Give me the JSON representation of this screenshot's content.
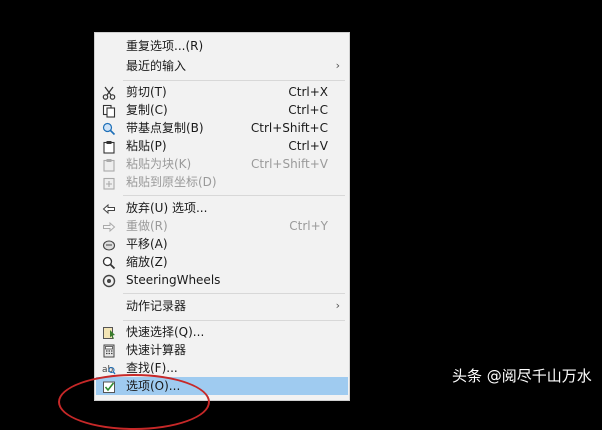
{
  "menu": {
    "items": [
      {
        "label": "重复选项...(R)",
        "shortcut": "",
        "submenu": false,
        "disabled": false,
        "icon": "none"
      },
      {
        "label": "最近的输入",
        "shortcut": "",
        "submenu": true,
        "disabled": false,
        "icon": "none"
      },
      {
        "label": "剪切(T)",
        "shortcut": "Ctrl+X",
        "submenu": false,
        "disabled": false,
        "icon": "scissors-icon"
      },
      {
        "label": "复制(C)",
        "shortcut": "Ctrl+C",
        "submenu": false,
        "disabled": false,
        "icon": "copy-icon"
      },
      {
        "label": "带基点复制(B)",
        "shortcut": "Ctrl+Shift+C",
        "submenu": false,
        "disabled": false,
        "icon": "copy-base-icon"
      },
      {
        "label": "粘贴(P)",
        "shortcut": "Ctrl+V",
        "submenu": false,
        "disabled": false,
        "icon": "paste-icon"
      },
      {
        "label": "粘贴为块(K)",
        "shortcut": "Ctrl+Shift+V",
        "submenu": false,
        "disabled": true,
        "icon": "paste-block-icon"
      },
      {
        "label": "粘贴到原坐标(D)",
        "shortcut": "",
        "submenu": false,
        "disabled": true,
        "icon": "paste-coords-icon"
      },
      {
        "label": "放弃(U) 选项...",
        "shortcut": "",
        "submenu": false,
        "disabled": false,
        "icon": "undo-icon"
      },
      {
        "label": "重做(R)",
        "shortcut": "Ctrl+Y",
        "submenu": false,
        "disabled": true,
        "icon": "redo-icon"
      },
      {
        "label": "平移(A)",
        "shortcut": "",
        "submenu": false,
        "disabled": false,
        "icon": "pan-icon"
      },
      {
        "label": "缩放(Z)",
        "shortcut": "",
        "submenu": false,
        "disabled": false,
        "icon": "zoom-icon"
      },
      {
        "label": "SteeringWheels",
        "shortcut": "",
        "submenu": false,
        "disabled": false,
        "icon": "steering-wheel-icon"
      },
      {
        "label": "动作记录器",
        "shortcut": "",
        "submenu": true,
        "disabled": false,
        "icon": "none"
      },
      {
        "label": "快速选择(Q)...",
        "shortcut": "",
        "submenu": false,
        "disabled": false,
        "icon": "quick-select-icon"
      },
      {
        "label": "快速计算器",
        "shortcut": "",
        "submenu": false,
        "disabled": false,
        "icon": "calculator-icon"
      },
      {
        "label": "查找(F)...",
        "shortcut": "",
        "submenu": false,
        "disabled": false,
        "icon": "find-icon"
      },
      {
        "label": "选项(O)...",
        "shortcut": "",
        "submenu": false,
        "disabled": false,
        "icon": "options-icon"
      }
    ],
    "submenu_arrow": "›",
    "highlighted_item": "选项(O)..."
  },
  "watermark": "头条 @阅尽千山万水",
  "colors": {
    "background": "#000000",
    "menu": "#f2f2f2",
    "highlight": "#9fcbf0",
    "annotation": "#c62828"
  }
}
